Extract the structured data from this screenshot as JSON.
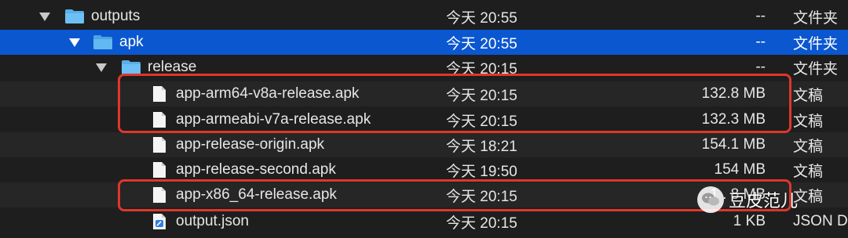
{
  "rows": [
    {
      "name": "outputs",
      "date": "今天 20:55",
      "size": "--",
      "kind": "文件夹"
    },
    {
      "name": "apk",
      "date": "今天 20:55",
      "size": "--",
      "kind": "文件夹"
    },
    {
      "name": "release",
      "date": "今天 20:15",
      "size": "--",
      "kind": "文件夹"
    },
    {
      "name": "app-arm64-v8a-release.apk",
      "date": "今天 20:15",
      "size": "132.8 MB",
      "kind": "文稿"
    },
    {
      "name": "app-armeabi-v7a-release.apk",
      "date": "今天 20:15",
      "size": "132.3 MB",
      "kind": "文稿"
    },
    {
      "name": "app-release-origin.apk",
      "date": "今天 18:21",
      "size": "154.1 MB",
      "kind": "文稿"
    },
    {
      "name": "app-release-second.apk",
      "date": "今天 19:50",
      "size": "154 MB",
      "kind": "文稿"
    },
    {
      "name": "app-x86_64-release.apk",
      "date": "今天 20:15",
      "size": "1 . 8 MB",
      "kind": "文稿"
    },
    {
      "name": "output.json",
      "date": "今天 20:15",
      "size": "1 KB",
      "kind": "JSON D"
    }
  ],
  "watermark": {
    "text": "豆皮范儿"
  },
  "colors": {
    "selection": "#0b57d0",
    "highlight": "#e0362b",
    "folder": "#5aaee8"
  }
}
